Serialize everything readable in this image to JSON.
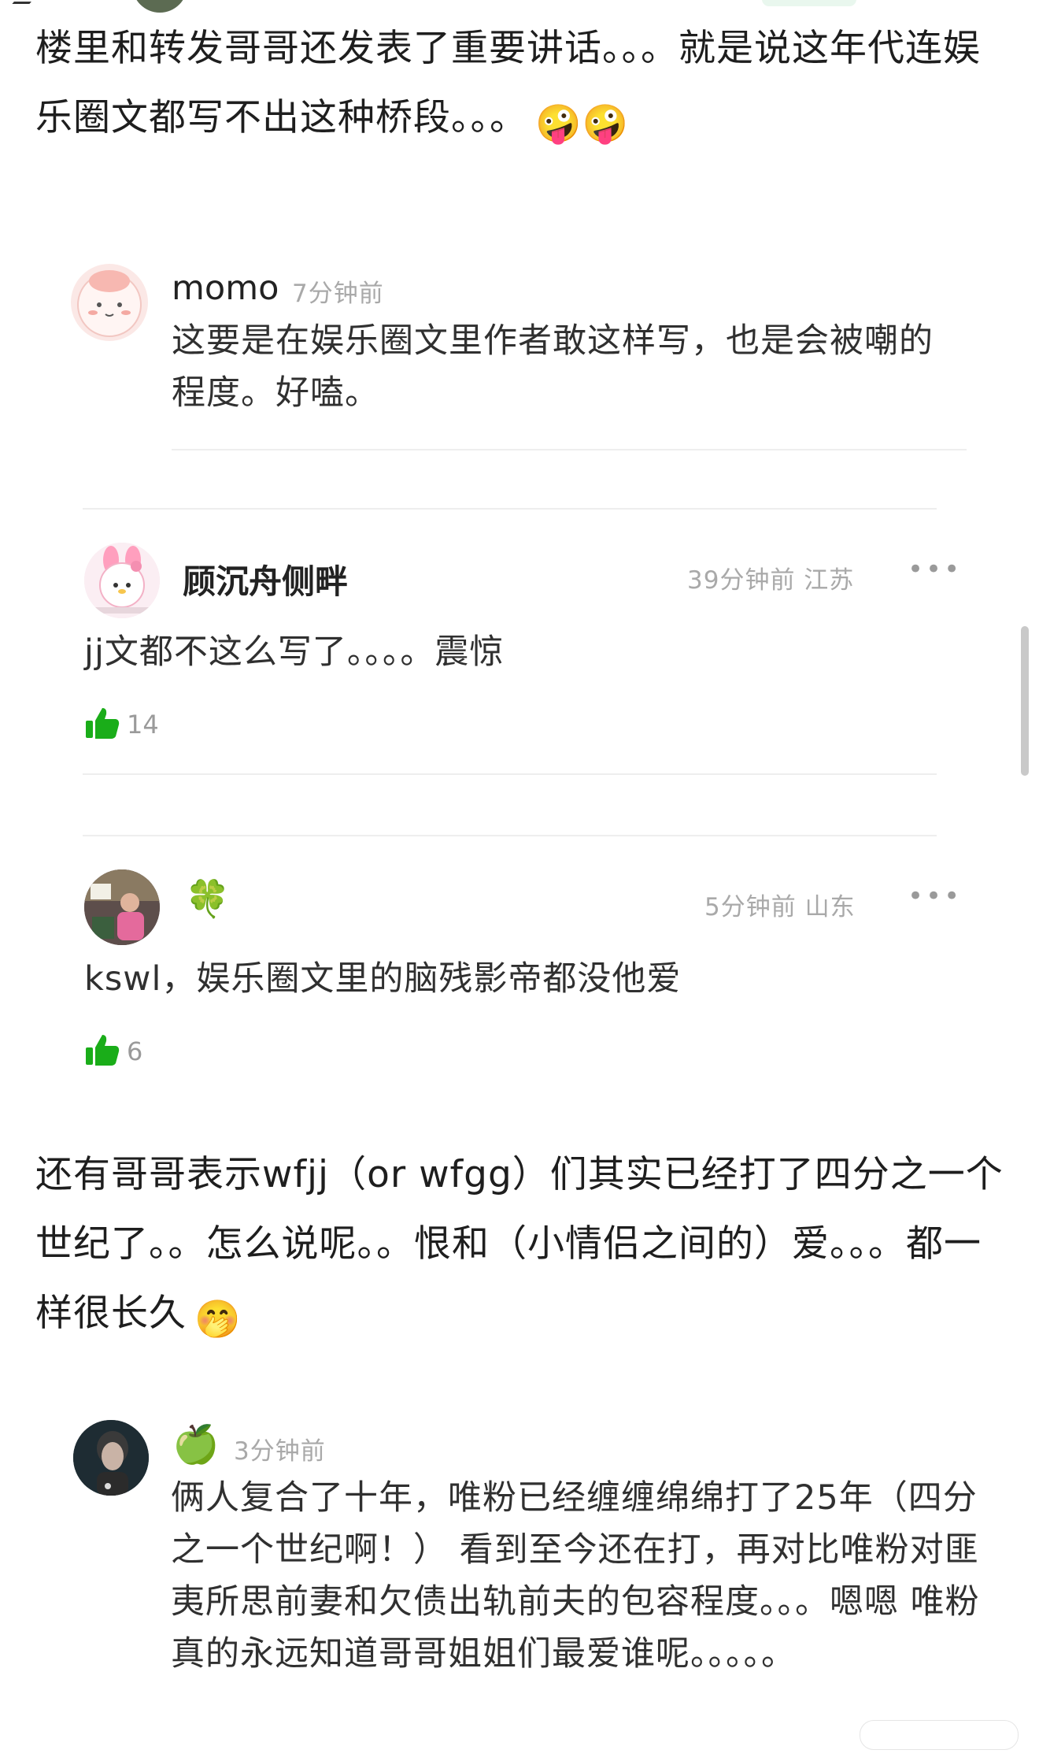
{
  "post": {
    "paragraph1": "楼里和转发哥哥还发表了重要讲话。。。就是说这年代连娱乐圈文都写不出这种桥段。。。",
    "paragraph2": "还有哥哥表示wfjj（or wfgg）们其实已经打了四分之一个世纪了。。怎么说呢。。恨和（小情侣之间的）爱。。。都一样很长久",
    "paragraph1_emoji": "🤪🤪",
    "paragraph2_emoji": "🤭"
  },
  "comments": [
    {
      "username": "momo",
      "time": "7分钟前",
      "text": "这要是在娱乐圈文里作者敢这样写，也是会被嘲的程度。好嗑。"
    },
    {
      "username": "顾沉舟侧畔",
      "time": "39分钟前 江苏",
      "text": "jj文都不这么写了。。。。震惊",
      "likes": "14",
      "more": "•••"
    },
    {
      "username_icon": "🍀",
      "time": "5分钟前 山东",
      "text": "kswl，娱乐圈文里的脑残影帝都没他爱",
      "likes": "6",
      "more": "•••"
    },
    {
      "username_icon": "🍏",
      "time": "3分钟前",
      "text": "俩人复合了十年，唯粉已经缠缠绵绵打了25年（四分之一个世纪啊！） 看到至今还在打，再对比唯粉对匪夷所思前妻和欠债出轨前夫的包容程度。。。嗯嗯 唯粉真的永远知道哥哥姐姐们最爱谁呢。。。。。"
    }
  ],
  "colors": {
    "like_green": "#1aad19",
    "muted": "#a9a9a9",
    "text": "#1e1e1e"
  }
}
